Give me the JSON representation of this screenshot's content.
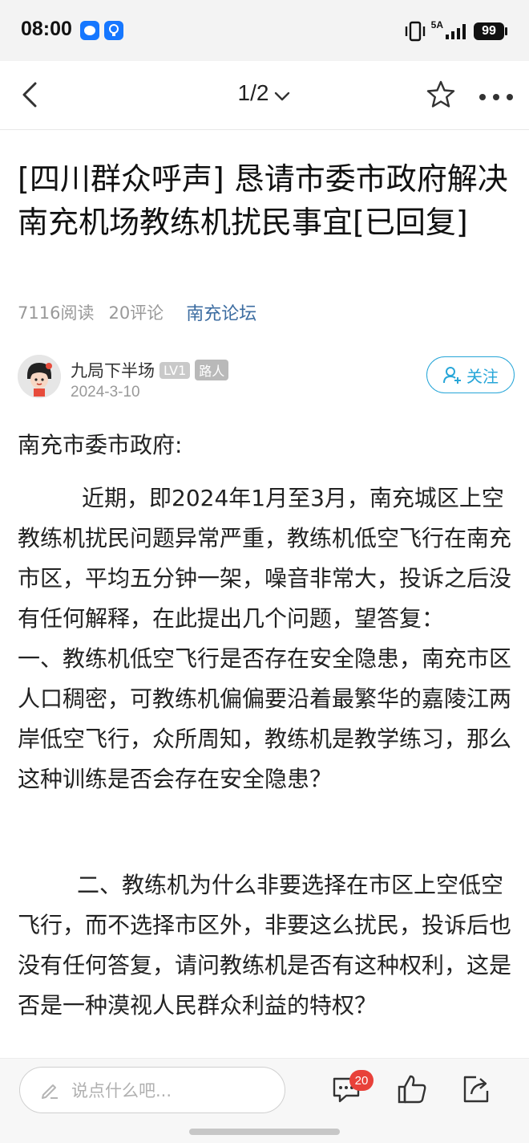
{
  "status_bar": {
    "time": "08:00",
    "network": "5A",
    "battery": "99"
  },
  "nav": {
    "page_indicator": "1/2"
  },
  "article": {
    "title": "[四川群众呼声] 恳请市委市政府解决南充机场教练机扰民事宜[已回复]",
    "reads": "7116阅读",
    "comments": "20评论",
    "forum": "南充论坛"
  },
  "author": {
    "name": "九局下半场",
    "level": "LV1",
    "role": "路人",
    "date": "2024-3-10",
    "follow_label": "关注"
  },
  "content": {
    "greeting": "南充市委市政府:",
    "paragraph1": "近期，即2024年1月至3月，南充城区上空教练机扰民问题异常严重，教练机低空飞行在南充市区，平均五分钟一架，噪音非常大，投诉之后没有任何解释，在此提出几个问题，望答复：　　　一、教练机低空飞行是否存在安全隐患，南充市区人口稠密，可教练机偏偏要沿着最繁华的嘉陵江两岸低空飞行，众所周知，教练机是教学练习，那么这种训练是否会存在安全隐患？",
    "paragraph2": "二、教练机为什么非要选择在市区上空低空飞行，而不选择市区外，非要这么扰民，投诉后也没有任何答复，请问教练机是否有这种权利，这是否是一种漠视人民群众利益的特权？"
  },
  "bottom_bar": {
    "input_placeholder": "说点什么吧...",
    "comment_count": "20"
  },
  "colors": {
    "accent": "#27a6d8",
    "forum_link": "#3d6da1",
    "badge_red": "#e8413a"
  },
  "icons": [
    "back-arrow-icon",
    "chevron-down-icon",
    "star-icon",
    "more-icon",
    "add-user-icon",
    "edit-icon",
    "comment-icon",
    "thumbs-up-icon",
    "share-icon"
  ]
}
